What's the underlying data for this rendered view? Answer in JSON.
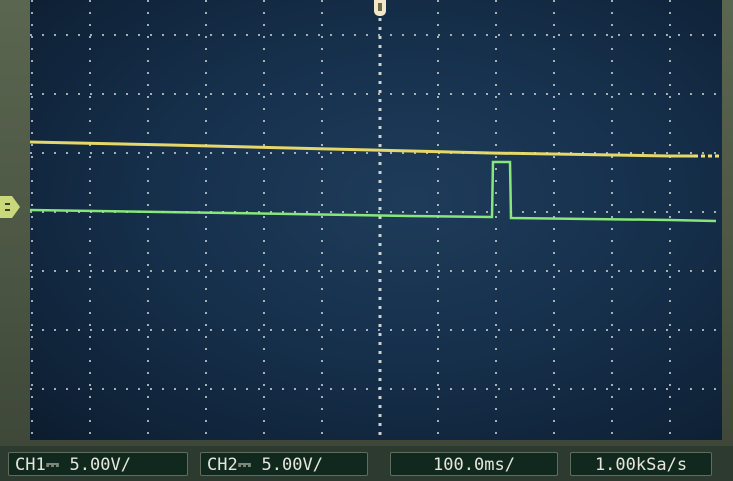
{
  "status": {
    "ch1_label": "CH1⎓",
    "ch1_scale": "5.00V/",
    "ch2_label": "CH2⎓",
    "ch2_scale": "5.00V/",
    "timebase": "100.0ms/",
    "sample_rate": "1.00kSa/s"
  },
  "colors": {
    "ch1_trace": "#f0e06a",
    "ch2_trace": "#8ef07c",
    "grid": "#d8dcd8",
    "screen_bg": "#16304c"
  },
  "icons": {
    "trigger_marker": "trigger-position-icon",
    "channel_marker": "channel-ground-icon"
  }
}
